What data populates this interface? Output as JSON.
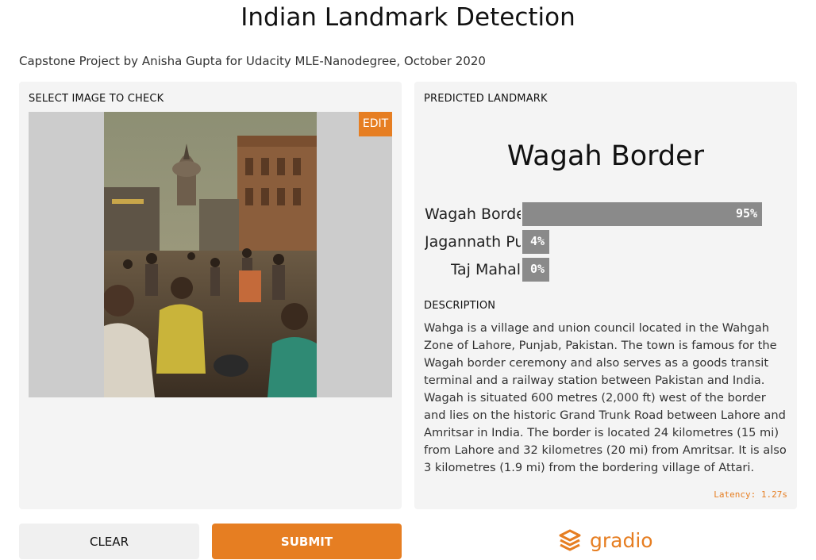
{
  "header": {
    "title": "Indian Landmark Detection",
    "subtitle": "Capstone Project by Anisha Gupta for Udacity MLE-Nanodegree, October 2020"
  },
  "input_panel": {
    "label": "SELECT IMAGE TO CHECK",
    "edit_label": "EDIT"
  },
  "output_panel": {
    "label": "PREDICTED LANDMARK",
    "prediction": "Wagah Border",
    "confidences": [
      {
        "name": "Wagah Border",
        "percent": 95,
        "percent_label": "95%"
      },
      {
        "name": "Jagannath Puri",
        "percent": 4,
        "percent_label": "4%"
      },
      {
        "name": "Taj Mahal",
        "percent": 0,
        "percent_label": "0%"
      }
    ],
    "description_label": "DESCRIPTION",
    "description": "Wahga is a village and union council located in the Wahgah Zone of Lahore, Punjab, Pakistan. The town is famous for the Wagah border ceremony and also serves as a goods transit terminal and a railway station between Pakistan and India. Wagah is situated 600 metres (2,000 ft) west of the border and lies on the historic Grand Trunk Road between Lahore and Amritsar in India. The border is located 24 kilometres (15 mi) from Lahore and 32 kilometres (20 mi) from Amritsar. It is also 3 kilometres (1.9 mi) from the bordering village of Attari.",
    "latency": "Latency: 1.27s"
  },
  "actions": {
    "clear_label": "CLEAR",
    "submit_label": "SUBMIT"
  },
  "brand": {
    "name": "gradio",
    "icon": "gradio-logo-icon"
  },
  "colors": {
    "accent": "#e67e22",
    "panel_bg": "#f4f4f4",
    "bar": "#8a8a8a"
  }
}
